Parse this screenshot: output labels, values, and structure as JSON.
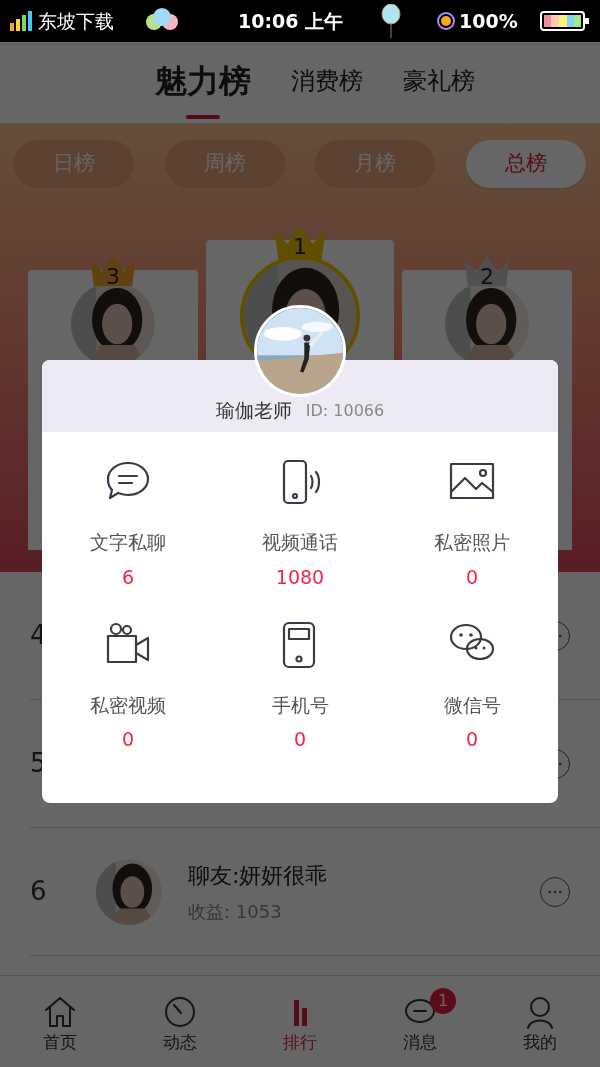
{
  "status_bar": {
    "carrier": "东坡下载",
    "time": "10:06 上午",
    "battery": "100%"
  },
  "tabs": [
    {
      "label": "魅力榜",
      "selected": true
    },
    {
      "label": "消费榜",
      "selected": false
    },
    {
      "label": "豪礼榜",
      "selected": false
    }
  ],
  "periods": [
    {
      "label": "日榜",
      "selected": false
    },
    {
      "label": "周榜",
      "selected": false
    },
    {
      "label": "月榜",
      "selected": false
    },
    {
      "label": "总榜",
      "selected": true
    }
  ],
  "podium": [
    {
      "rank": "3",
      "kind": "bronze"
    },
    {
      "rank": "1",
      "kind": "gold"
    },
    {
      "rank": "2",
      "kind": "silver"
    }
  ],
  "list": [
    {
      "rank": "4"
    },
    {
      "rank": "5"
    },
    {
      "rank": "6",
      "name": "聊友:妍妍很乖",
      "income": "收益: 1053"
    }
  ],
  "nav": [
    {
      "label": "首页",
      "selected": false
    },
    {
      "label": "动态",
      "selected": false
    },
    {
      "label": "排行",
      "selected": true
    },
    {
      "label": "消息",
      "selected": false,
      "badge": "1"
    },
    {
      "label": "我的",
      "selected": false
    }
  ],
  "dialog": {
    "name": "瑜伽老师",
    "id": "ID: 10066",
    "items": [
      {
        "label": "文字私聊",
        "value": "6"
      },
      {
        "label": "视频通话",
        "value": "1080"
      },
      {
        "label": "私密照片",
        "value": "0"
      },
      {
        "label": "私密视频",
        "value": "0"
      },
      {
        "label": "手机号",
        "value": "0"
      },
      {
        "label": "微信号",
        "value": "0"
      }
    ]
  }
}
